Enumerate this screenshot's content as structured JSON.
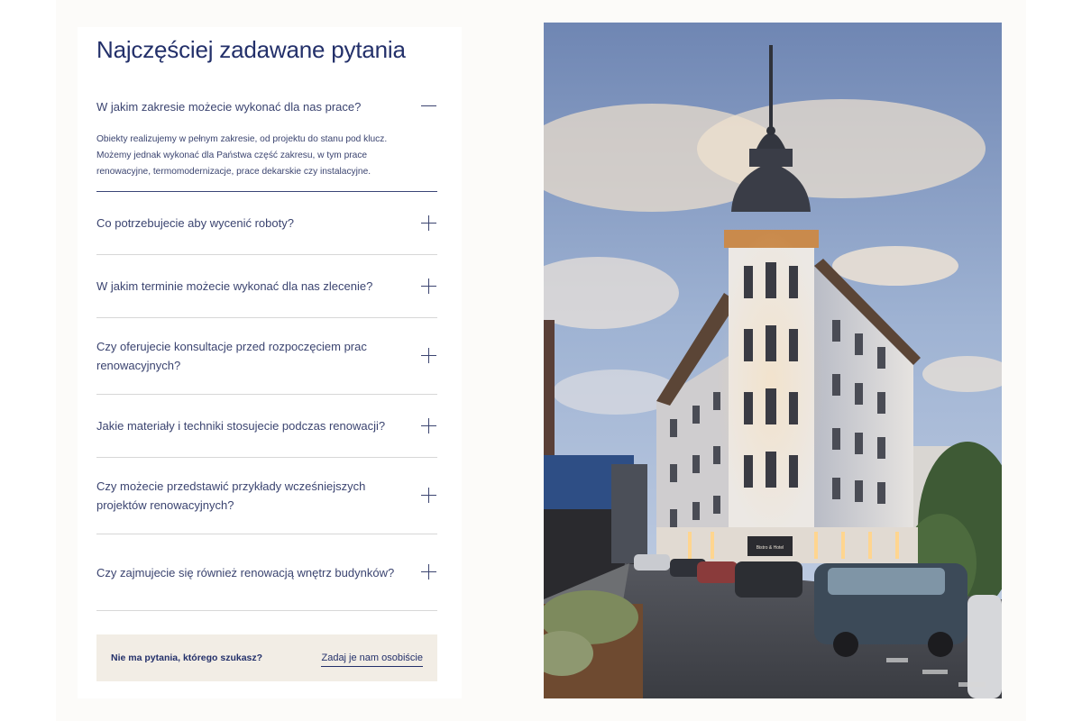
{
  "faq": {
    "title": "Najczęściej zadawane pytania",
    "items": [
      {
        "question": "W jakim zakresie możecie wykonać dla nas prace?",
        "answer": "Obiekty realizujemy w pełnym zakresie, od projektu do stanu pod klucz. Możemy jednak wykonać dla Państwa część zakresu, w tym prace renowacyjne, termomodernizacje, prace dekarskie czy instalacyjne.",
        "expanded": true
      },
      {
        "question": "Co potrzebujecie aby wycenić roboty?",
        "expanded": false
      },
      {
        "question": "W jakim terminie możecie wykonać dla nas zlecenie?",
        "expanded": false
      },
      {
        "question": "Czy oferujecie konsultacje przed rozpoczęciem prac renowacyjnych?",
        "expanded": false
      },
      {
        "question": "Jakie materiały i techniki stosujecie podczas renowacji?",
        "expanded": false
      },
      {
        "question": "Czy możecie przedstawić przykłady wcześniejszych projektów renowacyjnych?",
        "expanded": false
      },
      {
        "question": "Czy zajmujecie się również renowacją wnętrz budynków?",
        "expanded": false
      }
    ]
  },
  "cta": {
    "text": "Nie ma pytania, którego szukasz?",
    "link_label": "Zadaj je nam osobiście"
  },
  "photo": {
    "subject": "tenement-building-corner-tower-dusk",
    "sign_text": "Bistro & Hotel"
  },
  "colors": {
    "navy": "#23306a",
    "text": "#3b4470",
    "divider": "#d7d7d7",
    "cta_bg": "#f2ede5",
    "page_bg": "#fcfbf9"
  }
}
